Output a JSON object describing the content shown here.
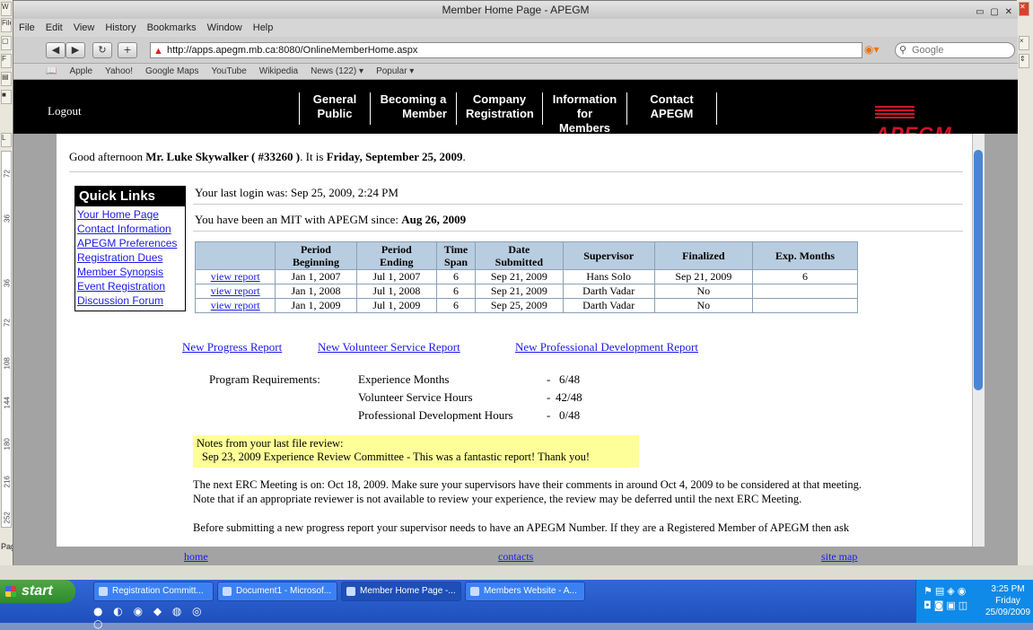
{
  "word": {
    "menu_file": "File",
    "ruler_numbers": [
      "72",
      "36",
      "36",
      "72",
      "108",
      "144",
      "180",
      "216",
      "252"
    ],
    "page_label": "Page"
  },
  "browser": {
    "title": "Member Home Page - APEGM",
    "menu": [
      "File",
      "Edit",
      "View",
      "History",
      "Bookmarks",
      "Window",
      "Help"
    ],
    "url": "http://apps.apegm.mb.ca:8080/OnlineMemberHome.aspx",
    "search_placeholder": "Google",
    "bookmarks": [
      "Apple",
      "Yahoo!",
      "Google Maps",
      "YouTube",
      "Wikipedia",
      "News (122) ▾",
      "Popular ▾"
    ]
  },
  "site": {
    "logout": "Logout",
    "nav": [
      {
        "line1": "General",
        "line2": "Public"
      },
      {
        "line1": "Becoming a",
        "line2": "Member"
      },
      {
        "line1": "Company",
        "line2": "Registration"
      },
      {
        "line1": "Information",
        "line2": "for Members"
      },
      {
        "line1": "Contact",
        "line2": "APEGM"
      }
    ],
    "logo_text": "APEGM"
  },
  "greeting": {
    "prefix": "Good afternoon ",
    "name": "Mr. Luke Skywalker ( #33260 )",
    "middle": ". It is ",
    "date": "Friday, September 25, 2009",
    "suffix": "."
  },
  "quick_links": {
    "title": "Quick Links",
    "items": [
      "Your Home Page",
      "Contact Information",
      "APEGM Preferences",
      "Registration Dues",
      "Member Synopsis",
      "Event Registration",
      "Discussion Forum"
    ]
  },
  "last_login": "Your last login was: Sep 25, 2009, 2:24 PM",
  "mit_since": {
    "prefix": "You have been an MIT with APEGM since: ",
    "date": "Aug 26, 2009"
  },
  "reports_table": {
    "headers": [
      {
        "line1": "Period",
        "line2": "Beginning"
      },
      {
        "line1": "Period",
        "line2": "Ending"
      },
      {
        "line1": "Time",
        "line2": "Span"
      },
      {
        "line1": "Date",
        "line2": "Submitted"
      },
      {
        "line1": "Supervisor",
        "line2": ""
      },
      {
        "line1": "Finalized",
        "line2": ""
      },
      {
        "line1": "Exp. Months",
        "line2": ""
      }
    ],
    "rows": [
      {
        "link": "view report",
        "begin": "Jan 1, 2007",
        "end": "Jul 1, 2007",
        "span": "6",
        "submitted": "Sep 21, 2009",
        "supervisor": "Hans Solo",
        "finalized": "Sep 21, 2009",
        "exp": "6"
      },
      {
        "link": "view report",
        "begin": "Jan 1, 2008",
        "end": "Jul 1, 2008",
        "span": "6",
        "submitted": "Sep 21, 2009",
        "supervisor": "Darth Vadar",
        "finalized": "No",
        "exp": ""
      },
      {
        "link": "view report",
        "begin": "Jan 1, 2009",
        "end": "Jul 1, 2009",
        "span": "6",
        "submitted": "Sep 25, 2009",
        "supervisor": "Darth Vadar",
        "finalized": "No",
        "exp": ""
      }
    ]
  },
  "action_links": {
    "progress": "New Progress Report",
    "volunteer": "New Volunteer Service Report",
    "professional": "New Professional Development Report"
  },
  "requirements": {
    "label": "Program Requirements:",
    "items": [
      {
        "name": "Experience Months",
        "dash": "-",
        "value": "6/48"
      },
      {
        "name": "Volunteer Service Hours",
        "dash": "-",
        "value": "42/48"
      },
      {
        "name": "Professional Development Hours",
        "dash": "-",
        "value": "0/48"
      }
    ]
  },
  "notes": {
    "title": "Notes from your last file review:",
    "entry": "Sep 23, 2009 Experience Review Committee - This was a fantastic report! Thank you!"
  },
  "erc": {
    "line1": "The next ERC Meeting is on: Oct 18, 2009. Make sure your supervisors have their comments in around Oct 4, 2009 to be considered at that meeting.",
    "line2": "Note that if an appropriate reviewer is not available to review your experience, the review may be deferred until the next ERC Meeting."
  },
  "before_submit": "Before submitting a new progress report your supervisor needs to have an APEGM Number. If they are a Registered Member of APEGM then ask",
  "footer": {
    "home": "home",
    "contacts": "contacts",
    "sitemap": "site map"
  },
  "taskbar": {
    "start": "start",
    "tasks": [
      "Registration Committ...",
      "Document1 - Microsof...",
      "Member Home Page -...",
      "Members Website - A..."
    ],
    "clock_time": "3:25 PM",
    "clock_day": "Friday",
    "clock_date": "25/09/2009"
  }
}
